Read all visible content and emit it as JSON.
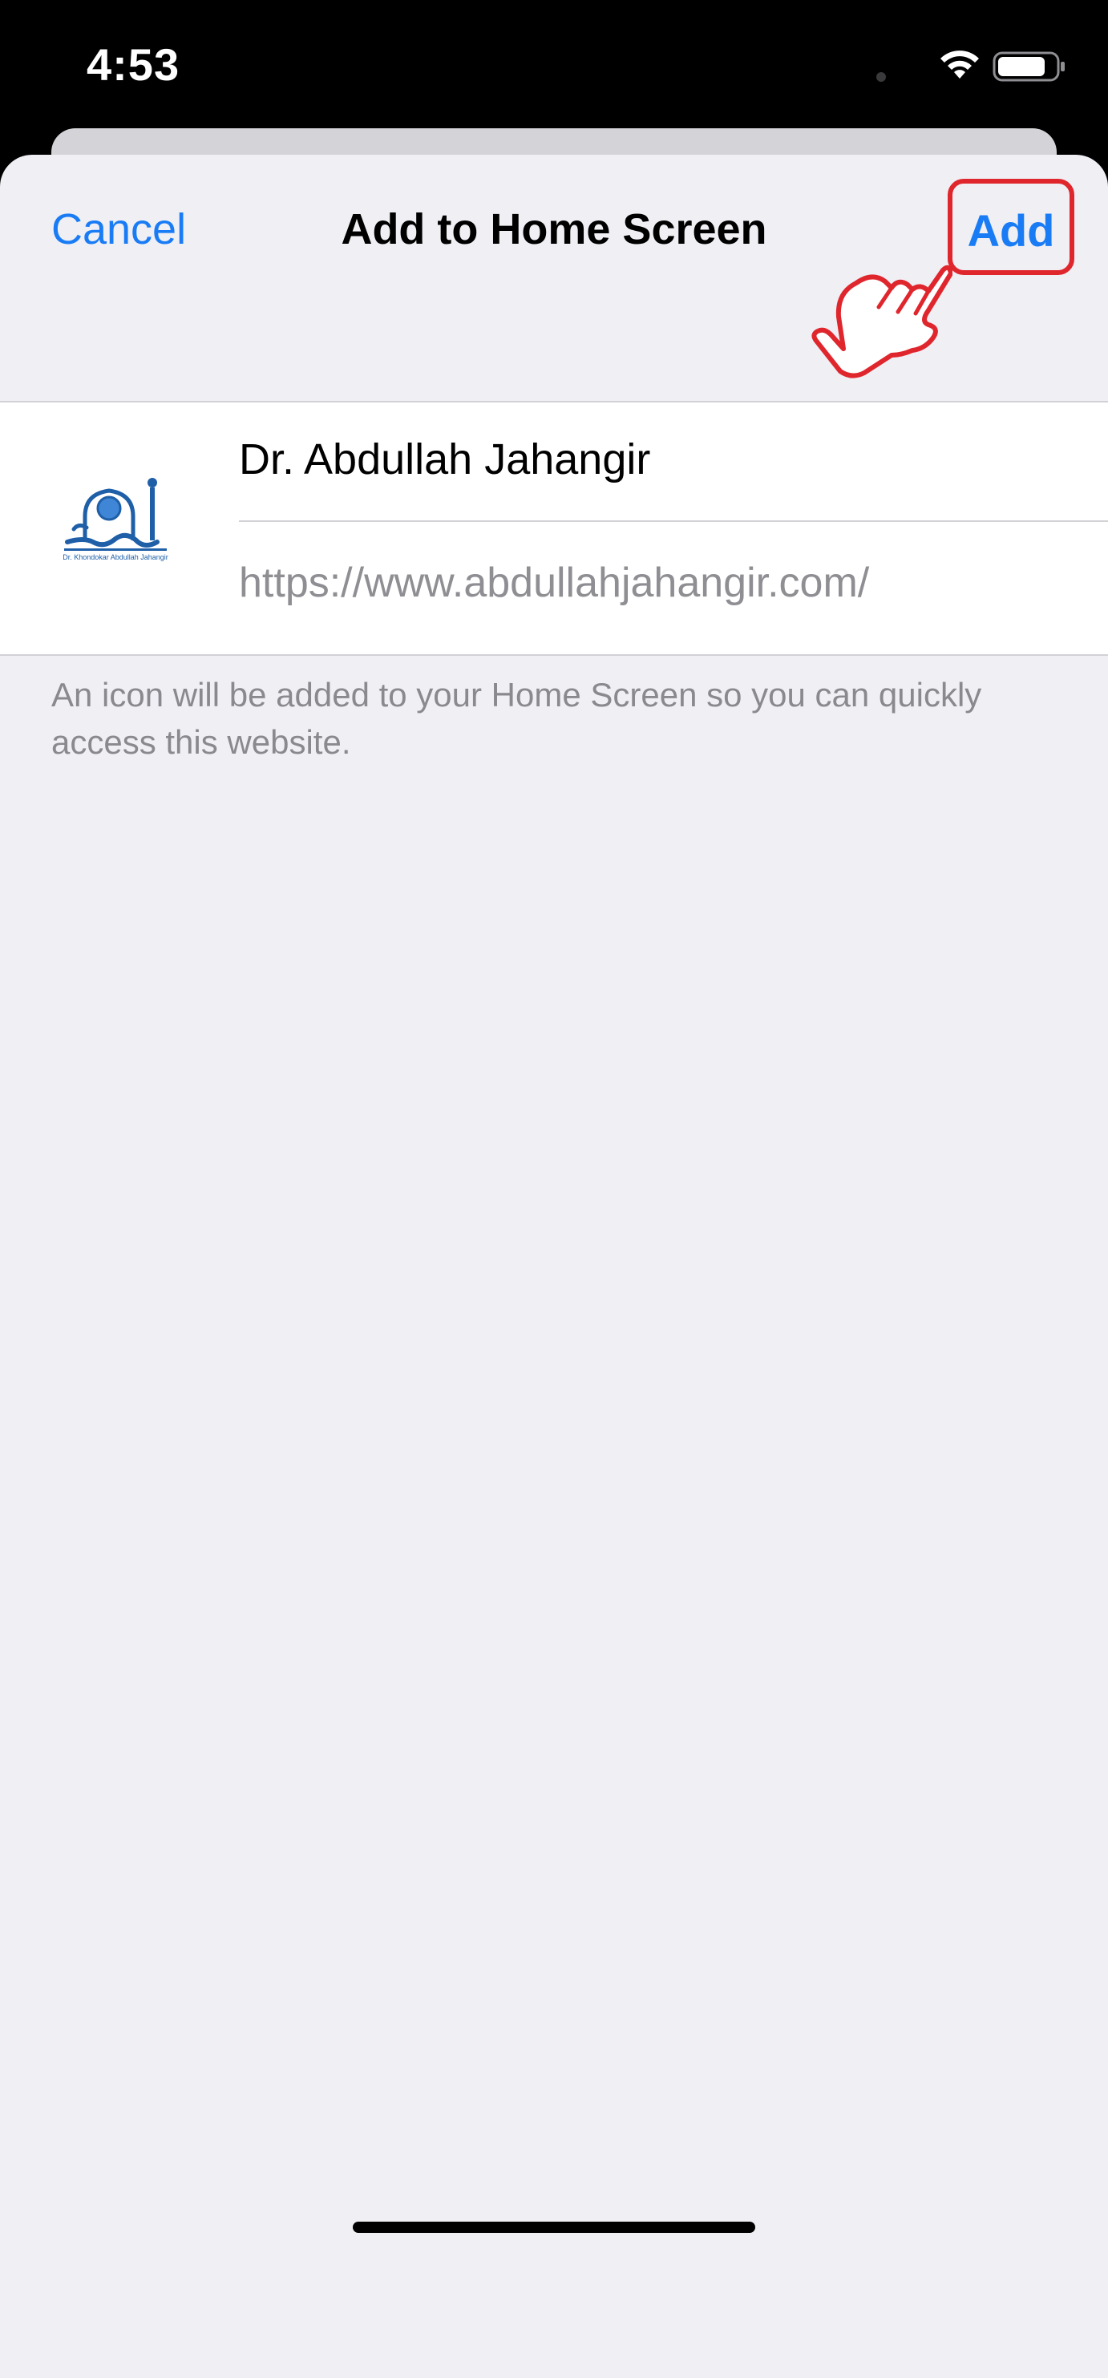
{
  "status_bar": {
    "time": "4:53"
  },
  "nav": {
    "cancel_label": "Cancel",
    "title": "Add to Home Screen",
    "add_label": "Add"
  },
  "bookmark": {
    "name": "Dr. Abdullah Jahangir",
    "url": "https://www.abdullahjahangir.com/",
    "icon": "site-logo-icon",
    "logo_caption": "Dr. Khondokar Abdullah Jahangir"
  },
  "footer": {
    "note": "An icon will be added to your Home Screen so you can quickly access this website."
  },
  "colors": {
    "accent": "#1a7cf5",
    "highlight": "#e0262d",
    "sheet_bg": "#efeff4",
    "logo_blue": "#1e5fa8"
  }
}
